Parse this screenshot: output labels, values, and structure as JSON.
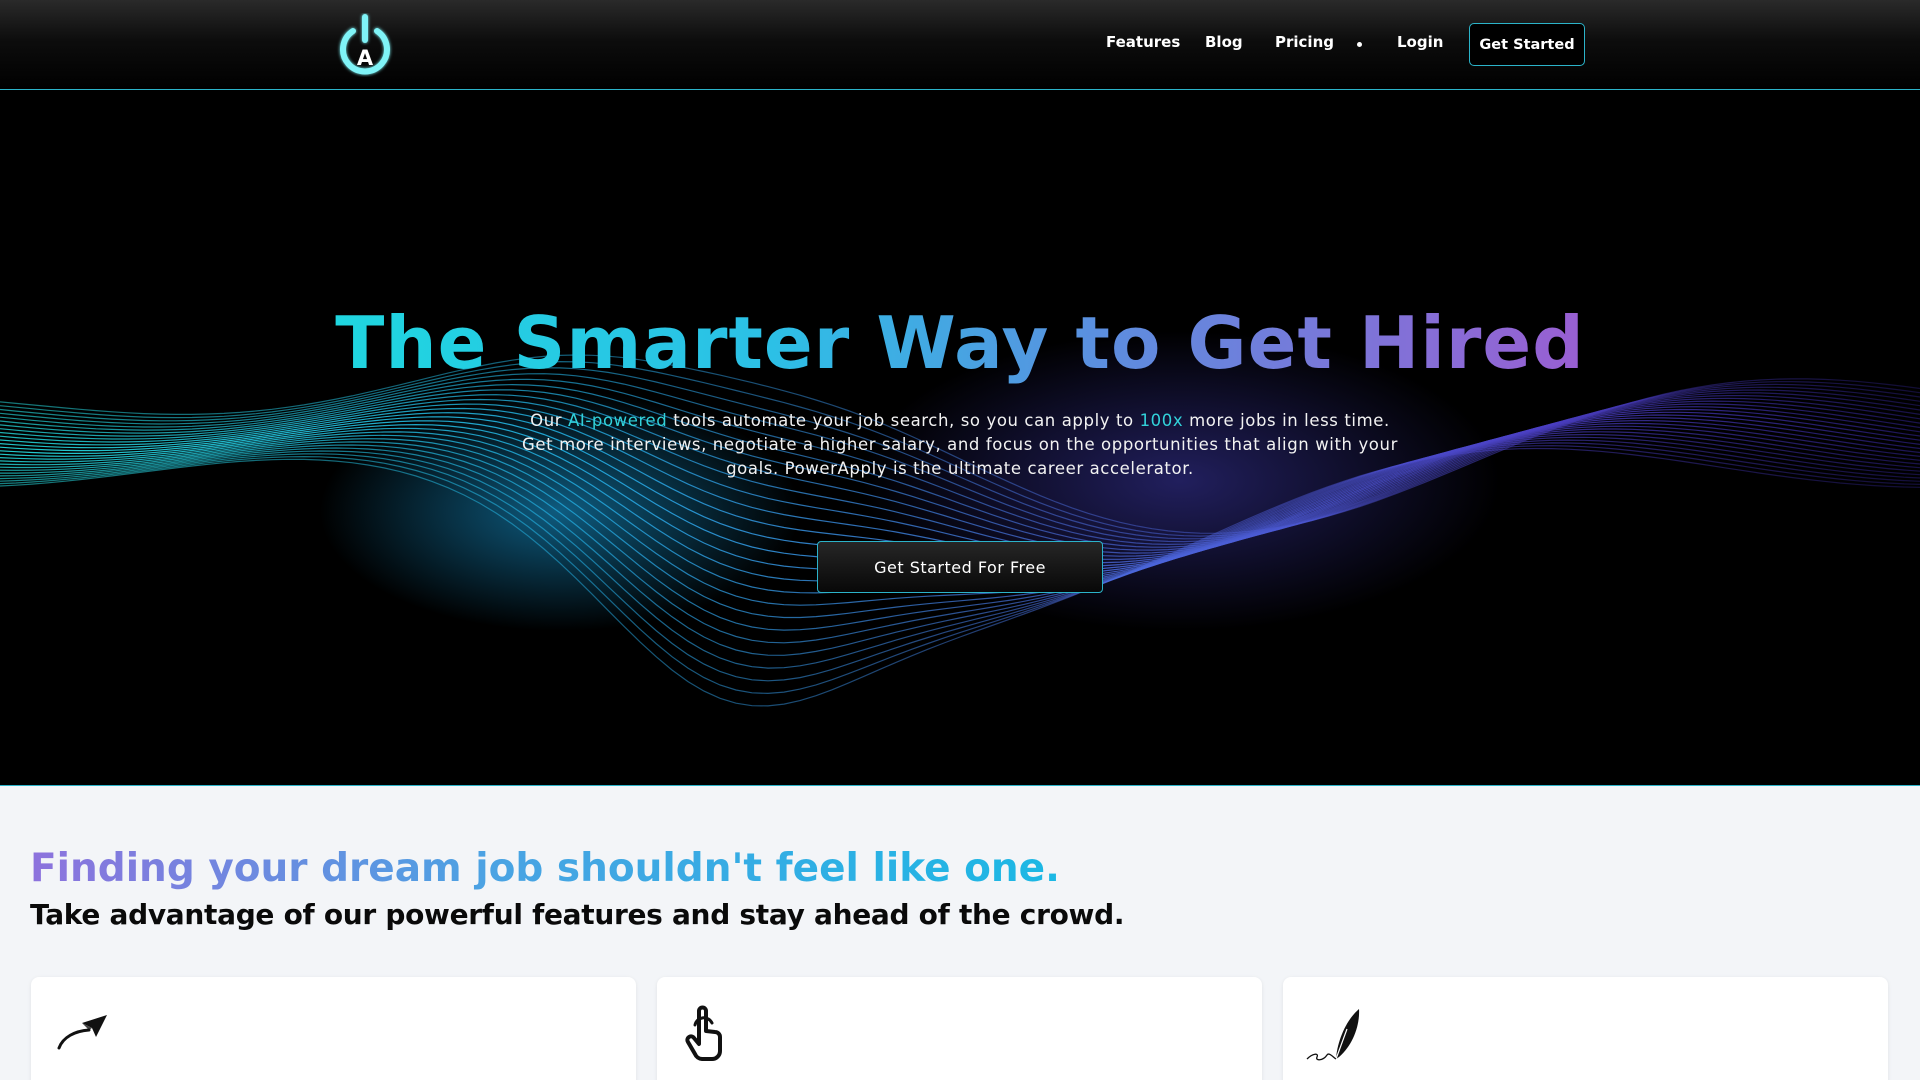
{
  "nav": {
    "logo_letter": "A",
    "links": [
      "Features",
      "Blog",
      "Pricing"
    ],
    "login": "Login",
    "cta": "Get Started"
  },
  "hero": {
    "title_words": [
      "The",
      "Smarter",
      "Way",
      "to",
      "Get",
      "Hired"
    ],
    "description": {
      "p1": "Our ",
      "h1": "AI-powered",
      "p2": " tools automate your job search, so you can apply to ",
      "h2": "100x",
      "p3": " more jobs in less time. Get more interviews, negotiate a higher salary, and focus on the opportunities that align with your goals. PowerApply is the ultimate career accelerator."
    },
    "cta": "Get Started For Free"
  },
  "features": {
    "title": "Finding your dream job shouldn't feel like one.",
    "subtitle": "Take advantage of our powerful features and stay ahead of the crowd.",
    "cards": [
      {
        "icon": "paper-plane-icon"
      },
      {
        "icon": "tap-hand-icon"
      },
      {
        "icon": "feather-quill-icon"
      }
    ]
  },
  "colors": {
    "accent_cyan": "#2bb3c9",
    "highlight": "#32d2da",
    "gradient_start": "#1fd6e0",
    "gradient_end": "#9a5ed2",
    "hero_bg": "#000000",
    "features_bg": "#f3f5f8"
  }
}
